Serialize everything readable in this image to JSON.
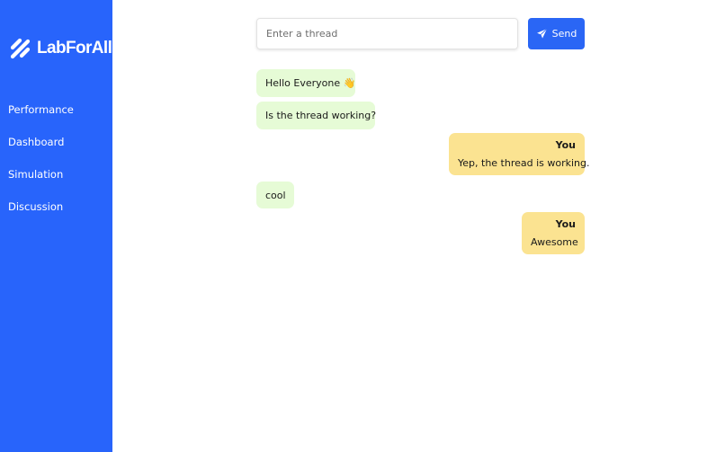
{
  "app": {
    "brand": "LabForAll",
    "colors": {
      "sidebar": "#2864fb",
      "send_button": "#2a66f5",
      "incoming_bubble": "#e6fbd6",
      "outgoing_bubble": "#fbe391"
    }
  },
  "sidebar": {
    "items": [
      {
        "label": "Performance"
      },
      {
        "label": "Dashboard"
      },
      {
        "label": "Simulation"
      },
      {
        "label": "Discussion"
      }
    ]
  },
  "composer": {
    "placeholder": "Enter a thread",
    "value": "",
    "send_label": "Send",
    "send_icon": "paper-plane-icon"
  },
  "messages": [
    {
      "direction": "incoming",
      "text": "Hello Everyone 👋"
    },
    {
      "direction": "incoming",
      "text": "Is the thread working?"
    },
    {
      "direction": "outgoing",
      "author": "You",
      "text": "Yep, the thread is working."
    },
    {
      "direction": "incoming",
      "text": "cool"
    },
    {
      "direction": "outgoing",
      "author": "You",
      "text": "Awesome"
    }
  ]
}
